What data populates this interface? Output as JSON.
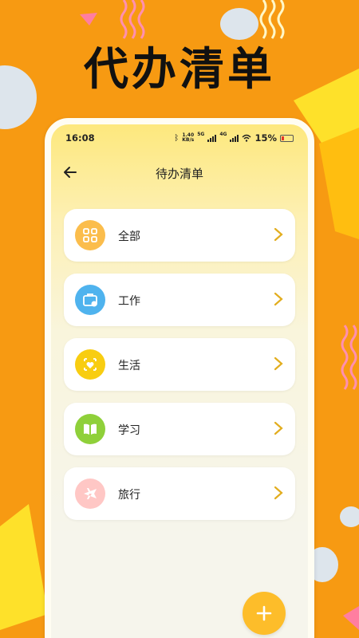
{
  "banner": {
    "title": "代办清单"
  },
  "status": {
    "time": "16:08",
    "speed_top": "1.40",
    "speed_unit": "KB/s",
    "net1": "5G",
    "net2": "4G",
    "battery": "15%"
  },
  "header": {
    "title": "待办清单"
  },
  "categories": [
    {
      "label": "全部",
      "icon": "grid-icon",
      "color": "#fbbd4c"
    },
    {
      "label": "工作",
      "icon": "briefcase-icon",
      "color": "#4fb3ee"
    },
    {
      "label": "生活",
      "icon": "heart-location-icon",
      "color": "#f8cd11"
    },
    {
      "label": "学习",
      "icon": "book-icon",
      "color": "#8fd03a"
    },
    {
      "label": "旅行",
      "icon": "airplane-icon",
      "color": "#ffc7c5"
    }
  ],
  "colors": {
    "background": "#f79a12",
    "accent": "#fdbd2a",
    "chevron": "#e2ad1e"
  }
}
